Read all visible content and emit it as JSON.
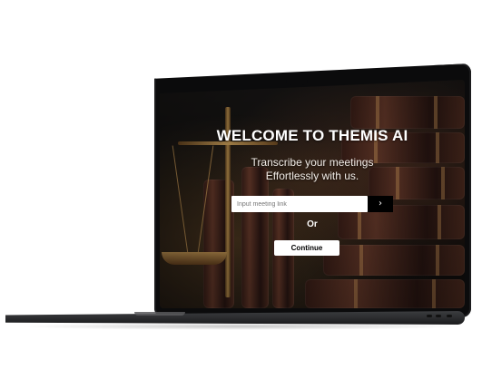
{
  "app": {
    "title": "WELCOME TO THEMIS AI",
    "subtitle_line1": "Transcribe your meetings",
    "subtitle_line2": "Effortlessly with us."
  },
  "meeting_link": {
    "placeholder": "Input meeting link",
    "value": "",
    "submit_icon": "chevron-right-icon"
  },
  "or_label": "Or",
  "continue_label": "Continue",
  "colors": {
    "accent": "#000000",
    "text": "#ffffff",
    "background": "#111010"
  }
}
